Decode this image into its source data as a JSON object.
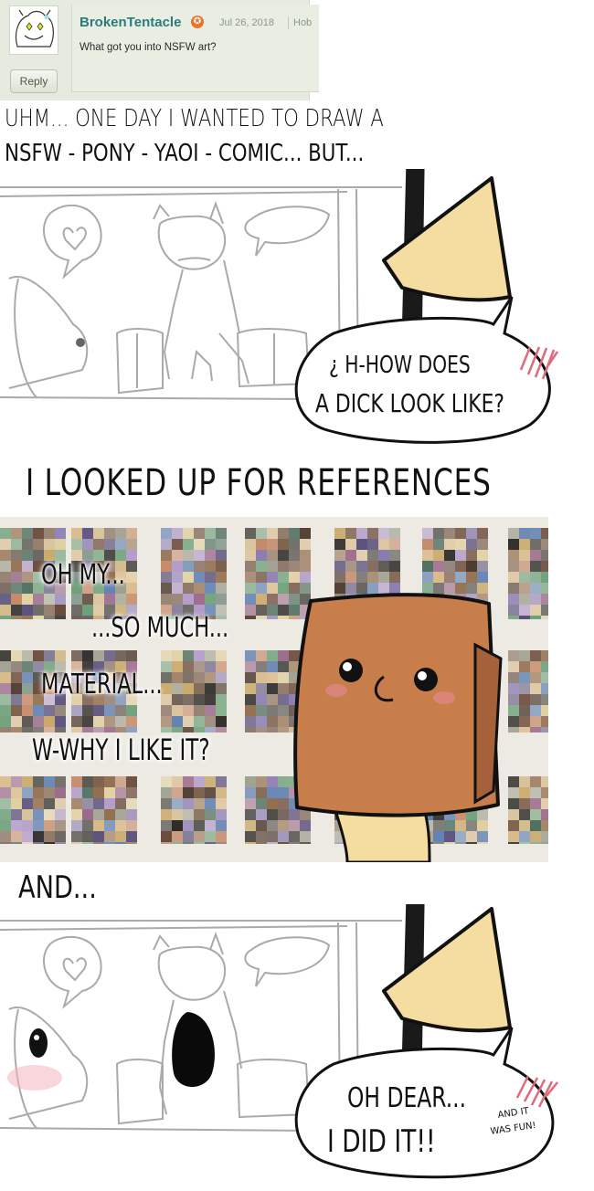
{
  "comment": {
    "username": "BrokenTentacle",
    "date": "Jul 26, 2018",
    "extra": "Hob",
    "text": "What got you into NSFW art?",
    "reply_label": "Reply",
    "badge_icon": "star-badge-icon",
    "accent_color": "#2c7b7c"
  },
  "captions": {
    "line1": "UHM... ONE DAY I WANTED TO DRAW A",
    "line2": "NSFW - PONY - YAOI - COMIC... BUT...",
    "references": "I LOOKED UP FOR REFERENCES",
    "and": "AND..."
  },
  "panel1": {
    "bubble_line1": "¿ H-HOW DOES",
    "bubble_line2": "A DICK LOOK LIKE?"
  },
  "panel2": {
    "text1": "OH MY...",
    "text2": "...SO MUCH...",
    "text3": "MATERIAL...",
    "text4": "W-WHY I LIKE IT?"
  },
  "panel3": {
    "bubble_line1": "OH DEAR...",
    "bubble_line2": "I DID IT!!",
    "aside1": "AND IT",
    "aside2": "WAS FUN!"
  }
}
